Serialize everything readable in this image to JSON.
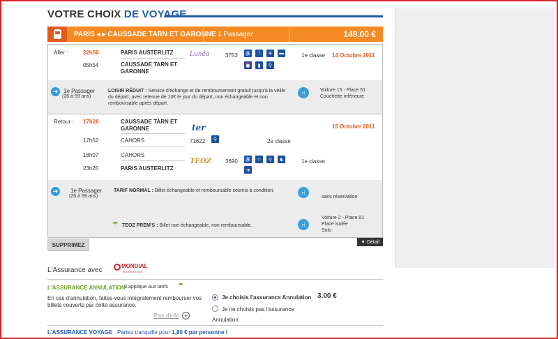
{
  "header": {
    "title_part1": "VOTRE CHOIX",
    "title_part2": "DE VOYAGE"
  },
  "summary_bar": {
    "route": "PARIS ◂ ▸ CAUSSADE TARN ET GARONNE",
    "passengers": "1 Passager",
    "price": "149.00 €"
  },
  "outbound": {
    "label": "Aller :",
    "dep_time": "22h56",
    "dep_station": "PARIS AUSTERLITZ",
    "arr_time": "05h54",
    "arr_station_line1": "CAUSSADE TARN ET",
    "arr_station_line2": "GARONNE",
    "brand": "Lunéa",
    "train_number": "3753",
    "class": "1e classe",
    "date": "14 Octobre 2011",
    "passenger": "1e Passager",
    "age": "(26 à 59 ans)",
    "fare_name": "LOISIR RÉDUIT :",
    "fare_desc": "Service d'échange et de remboursement gratuit jusqu'à la veille du départ, avec retenue de 10€ le jour du départ, non échangeable et non remboursable après départ.",
    "seat_line1": "Voiture 15 - Place 51",
    "seat_line2": "Couchette inférieure",
    "service_icons": [
      "wheelchair-icon",
      "info-icon",
      "restaurant-icon",
      "bed-icon",
      "alarm-icon",
      "bottle-icon",
      "bicycle-icon"
    ]
  },
  "return": {
    "label": "Retour :",
    "dep_time": "17h26",
    "dep_station_line1": "CAUSSADE TARN ET",
    "dep_station_line2": "GARONNE",
    "stop1_time": "17h52",
    "stop1_station": "CAHORS",
    "stop2_time": "18h07",
    "stop2_station": "CAHORS",
    "arr_time": "23h25",
    "arr_station": "PARIS AUSTERLITZ",
    "brand1": "ter",
    "train1_number": "71622",
    "class1": "2e classe",
    "brand2": "TEOZ",
    "train2_number": "3690",
    "class2": "1e classe",
    "date": "15 Octobre 2011",
    "passenger": "1e Passager",
    "age": "(26 à 59 ans)",
    "fare1_name": "TARIF NORMAL :",
    "fare1_desc": "Billet échangeable et remboursable soumis à condition.",
    "seat1": "sans réservation",
    "fare2_name": "TEOZ PREM'S :",
    "fare2_desc": "Billet non échangeable, non remboursable.",
    "seat2_line1": "Voiture 2 - Place 81",
    "seat2_line2": "Place isolée",
    "seat2_line3": "Solo"
  },
  "actions": {
    "delete": "SUPPRIMEZ",
    "detail": "▼ Détail"
  },
  "insurance": {
    "title": "L'Assurance avec",
    "provider": "MONDIAL",
    "provider_sub": "ASSISTANCE",
    "annulation_title": "L'ASSURANCE ANNULATION",
    "annulation_applies": "S'applique aux tarifs",
    "annulation_desc": "En cas d'annulation, faites-vous intégralement rembourser vos billets couverts par cette assurance.",
    "more_info": "Plus d'info",
    "option_yes": "Je choisis l'assurance Annulation",
    "option_yes_price": "3.00 €",
    "option_no_line1": "Je ne choisis pas l'assurance",
    "option_no_line2": "Annulation",
    "voyage_title": "L'ASSURANCE VOYAGE",
    "voyage_desc_part1": "Partez tranquille pour",
    "voyage_desc_price": "1,80 € par personne !"
  },
  "colors": {
    "accent_orange": "#f58a23",
    "title_blue": "#1f5aa6",
    "green": "#6ca12a"
  }
}
